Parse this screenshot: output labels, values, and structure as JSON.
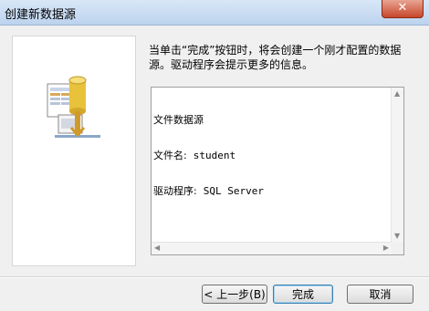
{
  "window": {
    "title": "创建新数据源",
    "close_glyph": "✕"
  },
  "message": "当单击“完成”按钮时，将会创建一个刚才配置的数据源。驱动程序会提示更多的信息。",
  "info": {
    "heading": "文件数据源",
    "file_name_label": "文件名:",
    "file_name_value": "student",
    "driver_label": "驱动程序:",
    "driver_value": "SQL Server"
  },
  "icons": {
    "illustration": "database-file-network-icon"
  },
  "buttons": {
    "back": "< 上一步(B)",
    "finish": "完成",
    "cancel": "取消"
  }
}
